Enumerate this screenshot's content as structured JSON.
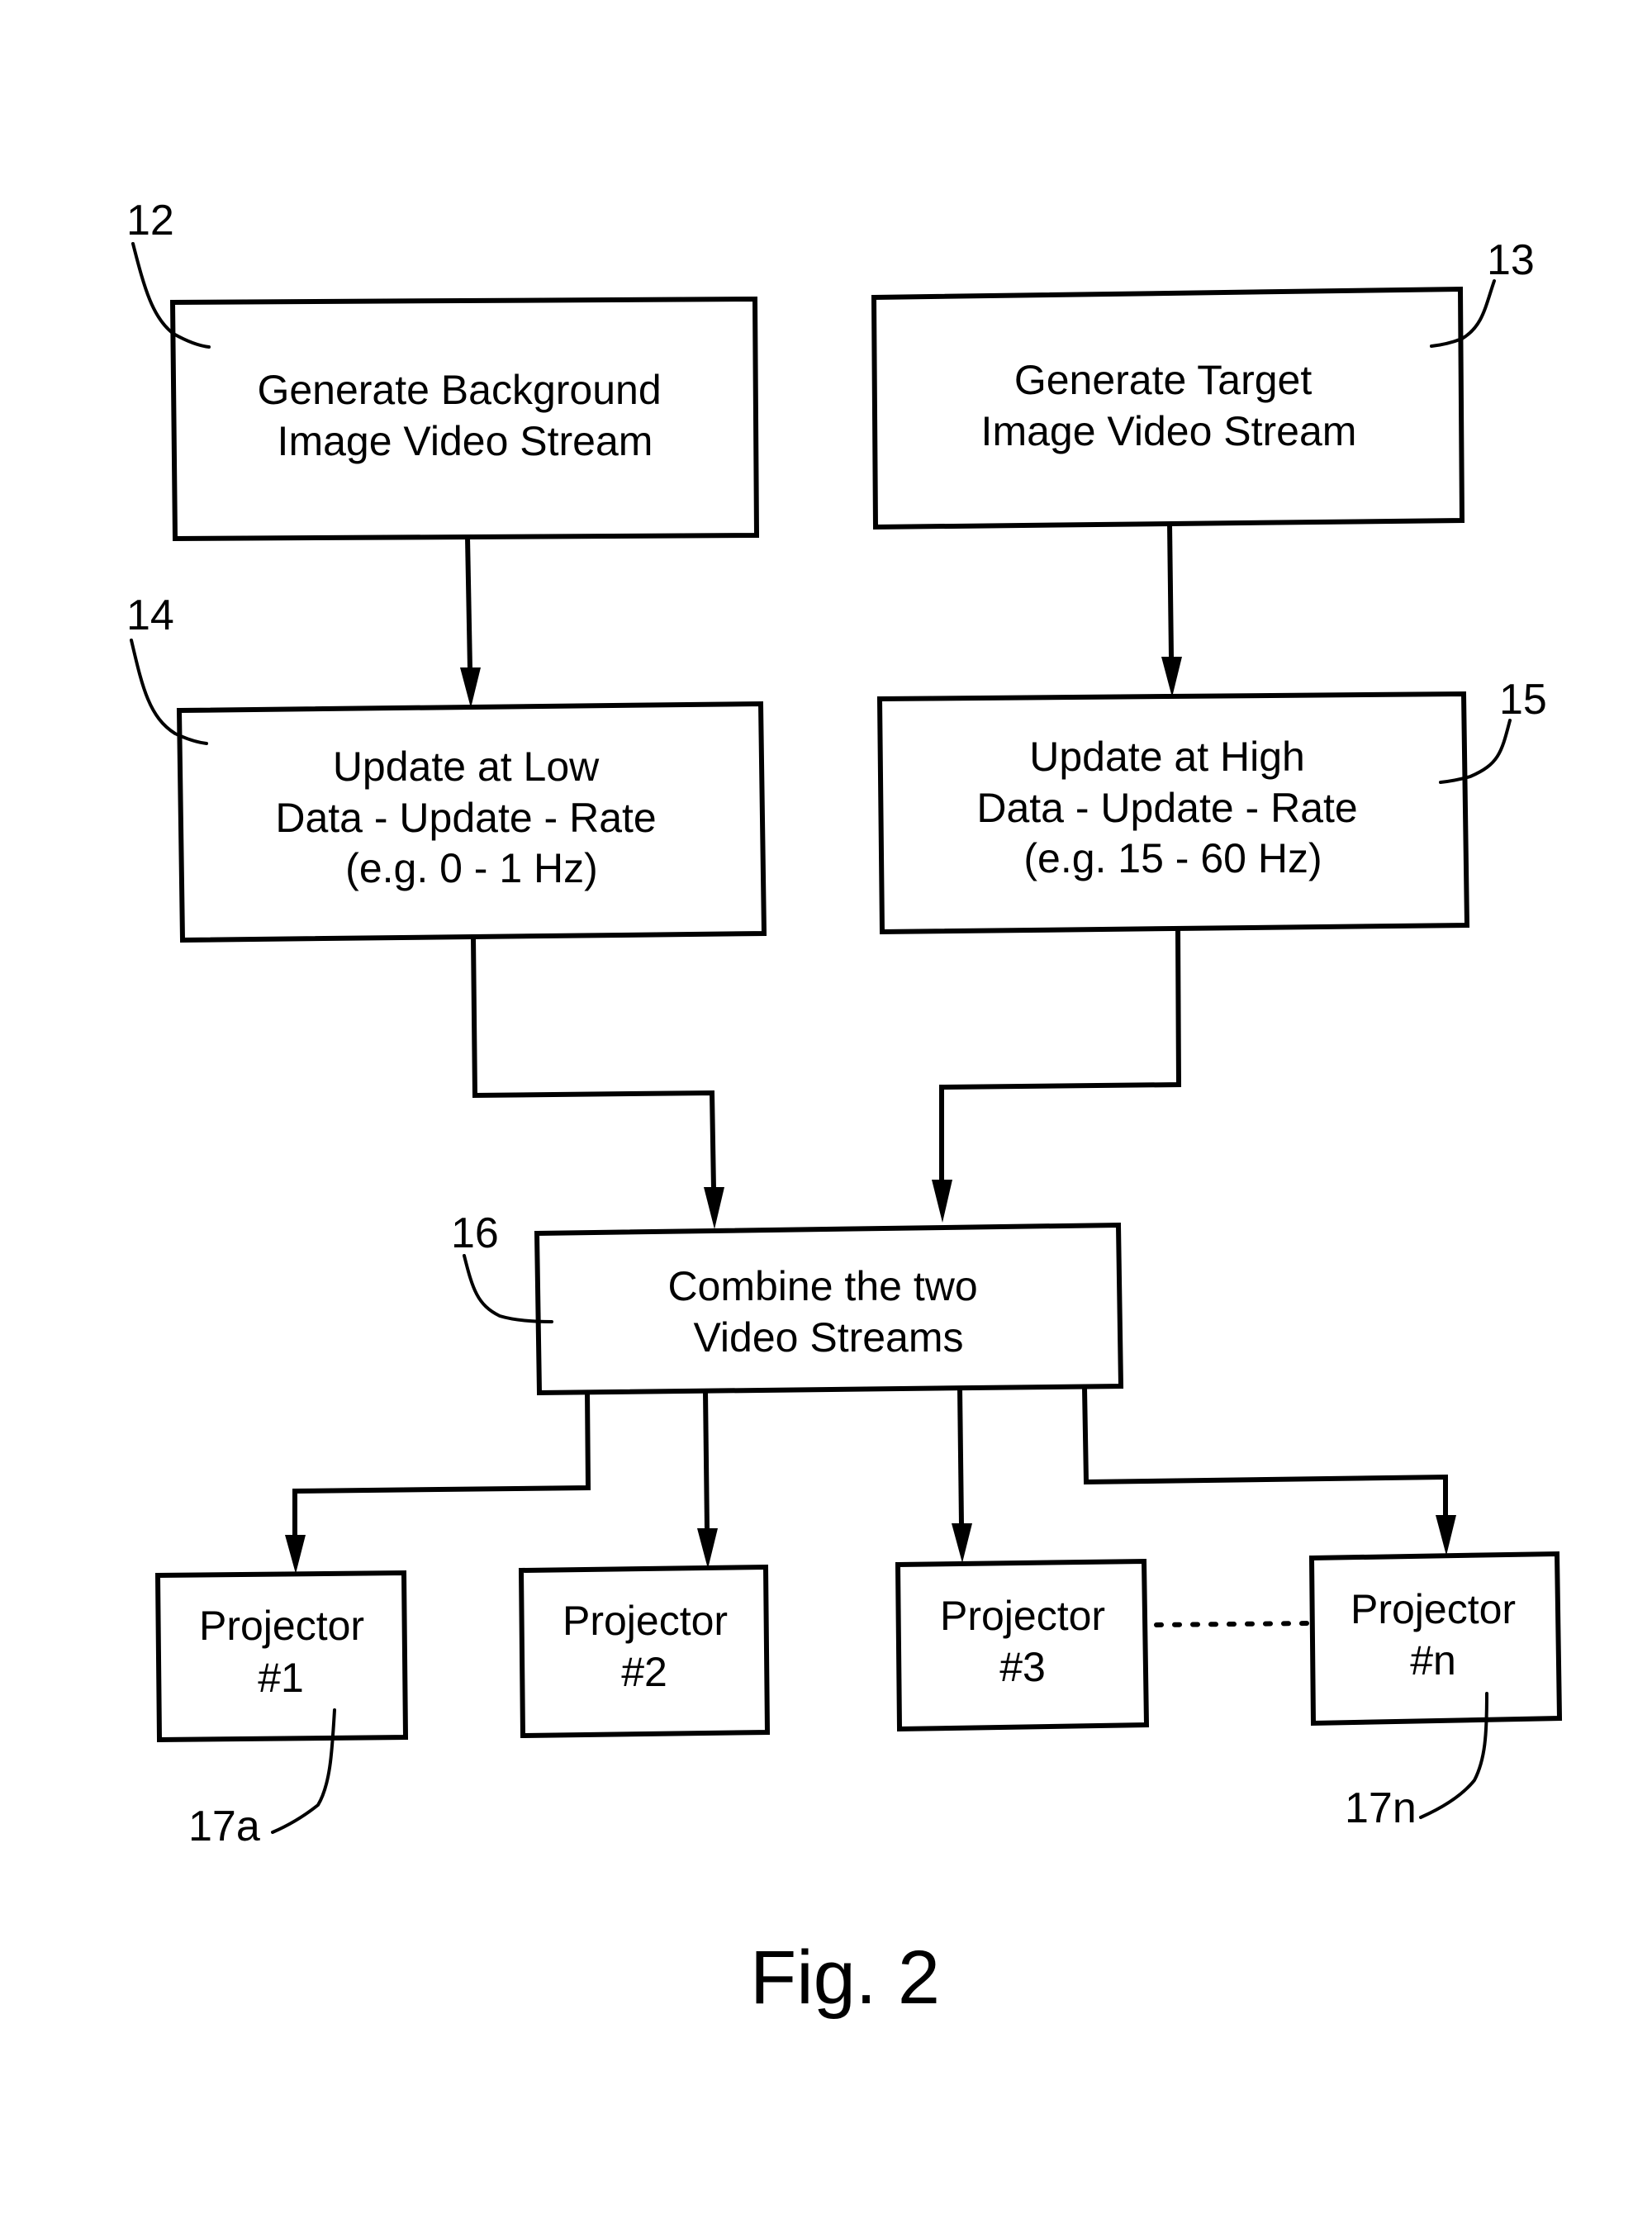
{
  "figure": {
    "caption": "Fig. 2",
    "type": "flowchart"
  },
  "nodes": [
    {
      "id": "12",
      "ref_label": "12",
      "lines": [
        "Generate Background",
        "Image Video Stream"
      ]
    },
    {
      "id": "13",
      "ref_label": "13",
      "lines": [
        "Generate Target",
        "Image Video Stream"
      ]
    },
    {
      "id": "14",
      "ref_label": "14",
      "lines": [
        "Update at Low",
        "Data - Update - Rate",
        "(e.g. 0 - 1 Hz)"
      ]
    },
    {
      "id": "15",
      "ref_label": "15",
      "lines": [
        "Update at High",
        "Data - Update - Rate",
        "(e.g. 15 - 60 Hz)"
      ]
    },
    {
      "id": "16",
      "ref_label": "16",
      "lines": [
        "Combine the two",
        "Video Streams"
      ]
    },
    {
      "id": "17a",
      "ref_label": "17a",
      "lines": [
        "Projector",
        "#1"
      ]
    },
    {
      "id": "17b",
      "ref_label": "",
      "lines": [
        "Projector",
        "#2"
      ]
    },
    {
      "id": "17c",
      "ref_label": "",
      "lines": [
        "Projector",
        "#3"
      ]
    },
    {
      "id": "17n",
      "ref_label": "17n",
      "lines": [
        "Projector",
        "#n"
      ]
    }
  ],
  "edges": [
    {
      "from": "12",
      "to": "14"
    },
    {
      "from": "13",
      "to": "15"
    },
    {
      "from": "14",
      "to": "16"
    },
    {
      "from": "15",
      "to": "16"
    },
    {
      "from": "16",
      "to": "17a"
    },
    {
      "from": "16",
      "to": "17b"
    },
    {
      "from": "16",
      "to": "17c"
    },
    {
      "from": "16",
      "to": "17n"
    }
  ],
  "ellipsis_between": [
    "17c",
    "17n"
  ]
}
